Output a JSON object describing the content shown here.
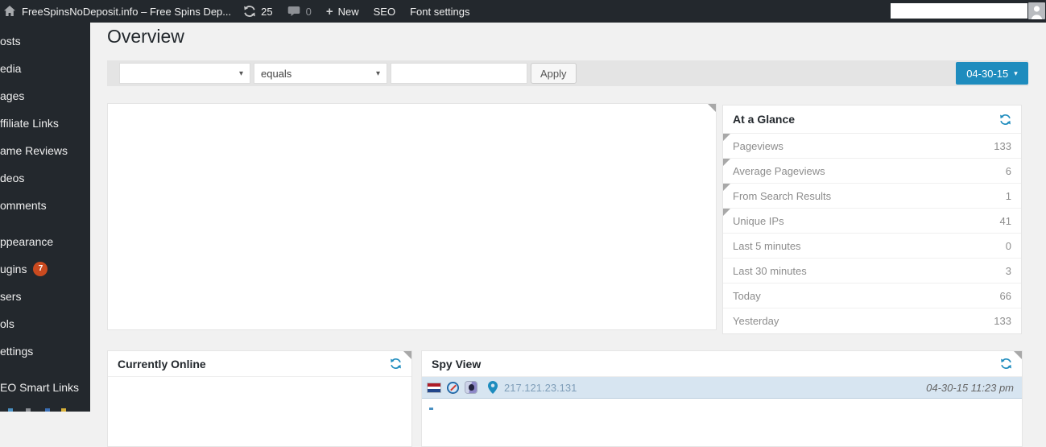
{
  "admin_bar": {
    "site_name": "FreeSpinsNoDeposit.info – Free Spins Dep...",
    "updates_count": "25",
    "comments_count": "0",
    "plus_glyph": "+",
    "new_label": "New",
    "seo_label": "SEO",
    "font_settings_label": "Font settings",
    "search_value": ""
  },
  "sidebar": {
    "items": [
      {
        "label": "osts"
      },
      {
        "label": "edia"
      },
      {
        "label": "ages"
      },
      {
        "label": "ffiliate Links"
      },
      {
        "label": "ame Reviews"
      },
      {
        "label": "deos"
      },
      {
        "label": "omments"
      },
      {
        "label": "ppearance"
      },
      {
        "label": "ugins",
        "badge": "7"
      },
      {
        "label": "sers"
      },
      {
        "label": "ols"
      },
      {
        "label": "ettings"
      },
      {
        "label": "EO Smart Links"
      }
    ]
  },
  "page": {
    "title": "Overview"
  },
  "filter_bar": {
    "field_select_value": "",
    "operator_select_value": "equals",
    "search_value": "",
    "apply_label": "Apply",
    "date_button_label": "04-30-15",
    "caret": "▾"
  },
  "widgets": {
    "at_a_glance": {
      "title": "At a Glance",
      "rows": [
        {
          "label": "Pageviews",
          "value": "133"
        },
        {
          "label": "Average Pageviews",
          "value": "6"
        },
        {
          "label": "From Search Results",
          "value": "1"
        },
        {
          "label": "Unique IPs",
          "value": "41"
        },
        {
          "label": "Last 5 minutes",
          "value": "0"
        },
        {
          "label": "Last 30 minutes",
          "value": "3"
        },
        {
          "label": "Today",
          "value": "66"
        },
        {
          "label": "Yesterday",
          "value": "133"
        }
      ]
    },
    "currently_online": {
      "title": "Currently Online"
    },
    "spy_view": {
      "title": "Spy View",
      "entry": {
        "ip": "217.121.23.131",
        "timestamp": "04-30-15 11:23 pm",
        "country_icon": "netherlands-flag-icon",
        "browser_icon": "safari-browser-icon",
        "os_icon": "macos-icon",
        "location_icon": "location-pin-icon"
      }
    }
  },
  "icons": {
    "home": "home-icon",
    "update": "update-refresh-icon",
    "comments": "comments-bubble-icon",
    "refresh": "refresh-icon",
    "avatar": "user-avatar-icon"
  },
  "colors": {
    "accent": "#1e8cbe",
    "admin_bar_bg": "#23282d",
    "plugins_badge_bg": "#ca4a1f",
    "spy_row_bg": "#d7e5f1",
    "page_bg": "#f1f1f1"
  }
}
